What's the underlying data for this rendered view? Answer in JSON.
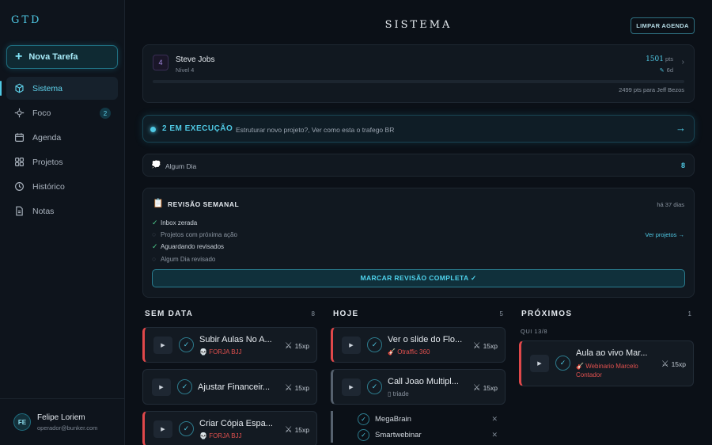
{
  "app": {
    "brand": "GTD",
    "new_task": "Nova Tarefa"
  },
  "nav": [
    {
      "label": "Sistema",
      "icon": "cube-icon",
      "active": true
    },
    {
      "label": "Foco",
      "icon": "target-icon",
      "badge": "2"
    },
    {
      "label": "Agenda",
      "icon": "calendar-icon"
    },
    {
      "label": "Projetos",
      "icon": "grid-icon"
    },
    {
      "label": "Histórico",
      "icon": "clock-icon"
    },
    {
      "label": "Notas",
      "icon": "note-icon"
    }
  ],
  "user": {
    "initials": "FE",
    "name": "Felipe Loriem",
    "email": "operador@bunker.com"
  },
  "header": {
    "title": "SISTEMA",
    "clear_button": "LIMPAR AGENDA"
  },
  "profile": {
    "level_badge": "4",
    "name": "Steve Jobs",
    "level": "Nível 4",
    "points": "1501",
    "points_unit": "pts",
    "streak": "6d",
    "progress": 0.0,
    "next": "2499 pts para Jeff Bezos"
  },
  "execution": {
    "label": "2 EM EXECUÇÃO",
    "text": "Estruturar novo projeto?, Ver como esta o trafego BR",
    "arrow": "→"
  },
  "someday": {
    "label": "Algum Dia",
    "count": "8"
  },
  "review": {
    "title": "REVISÃO SEMANAL",
    "ago": "há 37 dias",
    "link": "Ver projetos →",
    "button": "MARCAR REVISÃO COMPLETA ✓",
    "items": [
      {
        "label": "Inbox zerada",
        "done": true
      },
      {
        "label": "Projetos com próxima ação",
        "done": false
      },
      {
        "label": "Aguardando revisados",
        "done": true
      },
      {
        "label": "Algum Dia revisado",
        "done": false
      }
    ]
  },
  "columns": {
    "sem_data": {
      "title": "SEM DATA",
      "count": "8",
      "tasks": [
        {
          "name": "Subir Aulas No A...",
          "tag": "FORJA BJJ",
          "xp": "15xp"
        },
        {
          "name": "Ajustar Financeir...",
          "tag": "",
          "xp": "15xp"
        },
        {
          "name": "Criar Cópia Espa...",
          "tag": "FORJA BJJ",
          "xp": "15xp"
        }
      ]
    },
    "hoje": {
      "title": "HOJE",
      "count": "5",
      "tasks": [
        {
          "name": "Ver o slide do Flo...",
          "tag": "Otraffic 360",
          "xp": "15xp"
        },
        {
          "name": "Call Joao Multipl...",
          "tag": "triade",
          "xp": "15xp"
        }
      ],
      "subtasks": [
        "MegaBrain",
        "Smartwebinar"
      ]
    },
    "proximos": {
      "title": "PRÓXIMOS",
      "count": "1",
      "date": "QUI 13/8",
      "tasks": [
        {
          "name": "Aula ao vivo Mar...",
          "tag": "Webinario Marcelo Contador",
          "xp": "15xp"
        }
      ]
    }
  }
}
